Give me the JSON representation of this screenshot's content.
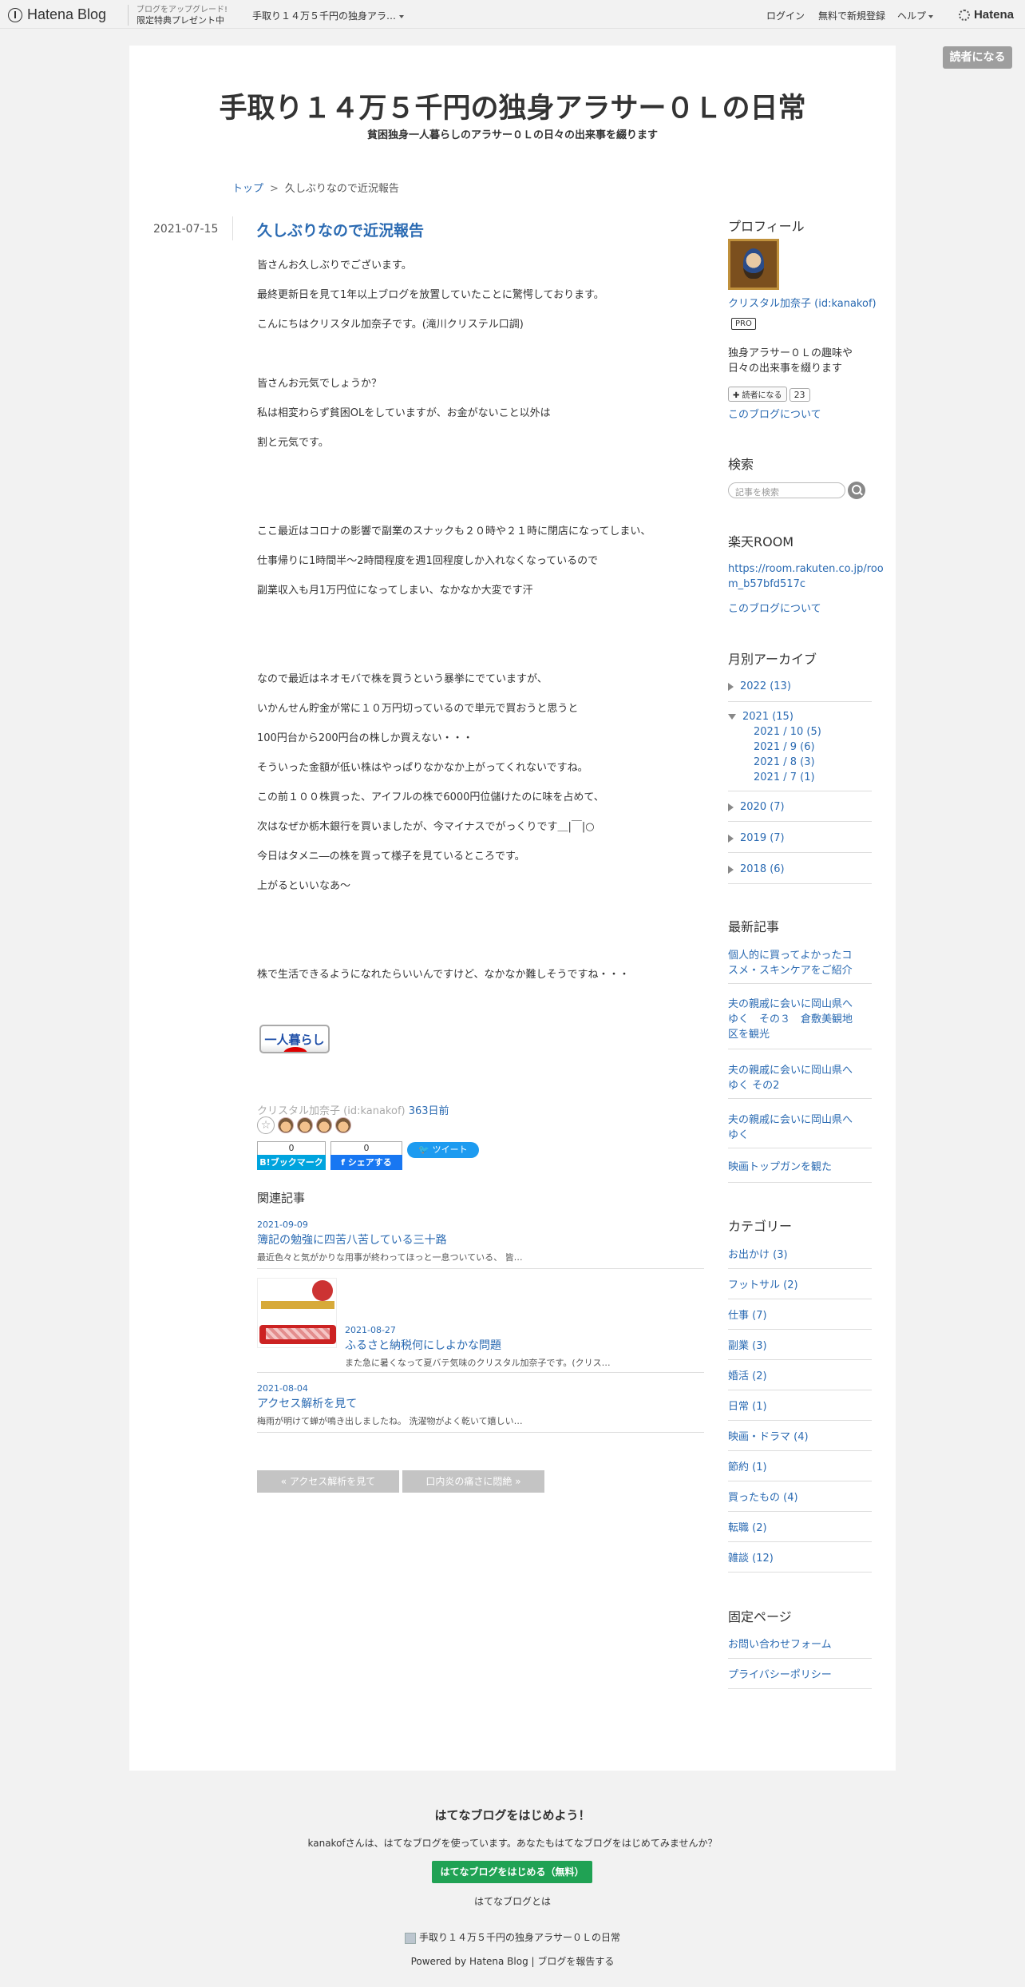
{
  "topbar": {
    "logo": "Hatena Blog",
    "promo_small": "ブログをアップグレード!",
    "promo_main": "限定特典プレゼント中",
    "blog_selector": "手取り１４万５千円の独身アラ…",
    "login": "ログイン",
    "signup": "無料で新規登録",
    "help": "ヘルプ",
    "brand": "Hatena"
  },
  "subscribe_float": "読者になる",
  "blog": {
    "title": "手取り１４万５千円の独身アラサー０Ｌの日常",
    "description": "貧困独身一人暮らしのアラサー０Ｌの日々の出来事を綴ります"
  },
  "breadcrumb": {
    "top": "トップ",
    "sep": ">",
    "current": "久しぶりなので近況報告"
  },
  "entry": {
    "date": "2021-07-15",
    "title": "久しぶりなので近況報告",
    "paragraphs": [
      "皆さんお久しぶりでございます。",
      "最終更新日を見て1年以上ブログを放置していたことに驚愕しております。",
      "こんにちはクリスタル加奈子です。(滝川クリステル口調)",
      "皆さんお元気でしょうか？",
      "私は相変わらず貧困OLをしていますが、お金がないこと以外は",
      "割と元気です。",
      "ここ最近はコロナの影響で副業のスナックも２０時や２１時に閉店になってしまい、",
      "仕事帰りに1時間半～2時間程度を週1回程度しか入れなくなっているので",
      "副業収入も月1万円位になってしまい、なかなか大変です汗",
      "なので最近はネオモバで株を買うという暴挙にでていますが、",
      "いかんせん貯金が常に１０万円切っているので単元で買おうと思うと",
      "100円台から200円台の株しか買えない・・・",
      "そういった金額が低い株はやっぱりなかなか上がってくれないですね。",
      "この前１００株買った、アイフルの株で6000円位儲けたのに味を占めて、",
      "次はなぜか栃木銀行を買いましたが、今マイナスでがっくりです＿|￣|○",
      "今日はタメニ―の株を買って様子を見ているところです。",
      "上がるといいなあ～",
      "株で生活できるようになれたらいいんですけど、なかなか難しそうですね・・・"
    ],
    "banner": "一人暮らし",
    "author": "クリスタル加奈子 (id:kanakof)",
    "ago": "363日前",
    "star_add": "☆",
    "bookmark_count": "0",
    "bookmark_label": "B!ブックマーク",
    "share_count": "0",
    "share_label": "f シェアする",
    "tweet_label": "ツイート"
  },
  "related": {
    "heading": "関連記事",
    "items": [
      {
        "date": "2021-09-09",
        "title": "簿記の勉強に四苦八苦している三十路",
        "excerpt": "最近色々と気がかりな用事が終わってほっと一息ついている、 皆…"
      },
      {
        "date": "2021-08-27",
        "title": "ふるさと納税何にしよかな問題",
        "excerpt": "また急に暑くなって夏バテ気味のクリスタル加奈子です。(クリス…"
      },
      {
        "date": "2021-08-04",
        "title": "アクセス解析を見て",
        "excerpt": "梅雨が明けて蝉が鳴き出しましたね。 洗濯物がよく乾いて嬉しい…"
      }
    ]
  },
  "pager": {
    "prev": "« アクセス解析を見て",
    "next": "口内炎の痛さに悶絶 »"
  },
  "sidebar": {
    "profile": {
      "heading": "プロフィール",
      "name": "クリスタル加奈子 (id:kanakof)",
      "pro": "PRO",
      "bio1": "独身アラサー０Ｌの趣味や",
      "bio2": "日々の出来事を綴ります",
      "subscribe": "✚ 読者になる",
      "subscribers": "23",
      "about": "このブログについて"
    },
    "search": {
      "heading": "検索",
      "placeholder": "記事を検索"
    },
    "rakuten": {
      "heading": "楽天ROOM",
      "url1": "https://room.rakuten.co.jp/roo",
      "url2": "m_b57bfd517c",
      "about": "このブログについて"
    },
    "archive": {
      "heading": "月別アーカイブ",
      "years": [
        "2022 (13)",
        "2021 (15)",
        "2020 (7)",
        "2019 (7)",
        "2018 (6)"
      ],
      "months": [
        "2021 / 10 (5)",
        "2021 / 9 (6)",
        "2021 / 8 (3)",
        "2021 / 7 (1)"
      ]
    },
    "recent": {
      "heading": "最新記事",
      "items": [
        [
          "個人的に買ってよかったコ",
          "スメ・スキンケアをご紹介"
        ],
        [
          "夫の親戚に会いに岡山県へ",
          "ゆく　その３　倉敷美観地",
          "区を観光"
        ],
        [
          "夫の親戚に会いに岡山県へ",
          "ゆく その2"
        ],
        [
          "夫の親戚に会いに岡山県へ",
          "ゆく"
        ],
        [
          "映画トップガンを観た"
        ]
      ]
    },
    "category": {
      "heading": "カテゴリー",
      "items": [
        "お出かけ (3)",
        "フットサル (2)",
        "仕事 (7)",
        "副業 (3)",
        "婚活 (2)",
        "日常 (1)",
        "映画・ドラマ (4)",
        "節約 (1)",
        "買ったもの (4)",
        "転職 (2)",
        "雑談 (12)"
      ]
    },
    "fixed": {
      "heading": "固定ページ",
      "items": [
        "お問い合わせフォーム",
        "プライバシーポリシー"
      ]
    }
  },
  "footer": {
    "heading": "はてなブログをはじめよう！",
    "message": "kanakofさんは、はてなブログを使っています。あなたもはてなブログをはじめてみませんか？",
    "start_button": "はてなブログをはじめる（無料）",
    "about": "はてなブログとは",
    "blog_name": "手取り１４万５千円の独身アラサー０Ｌの日常",
    "powered": "Powered by Hatena Blog",
    "report": "ブログを報告する"
  }
}
